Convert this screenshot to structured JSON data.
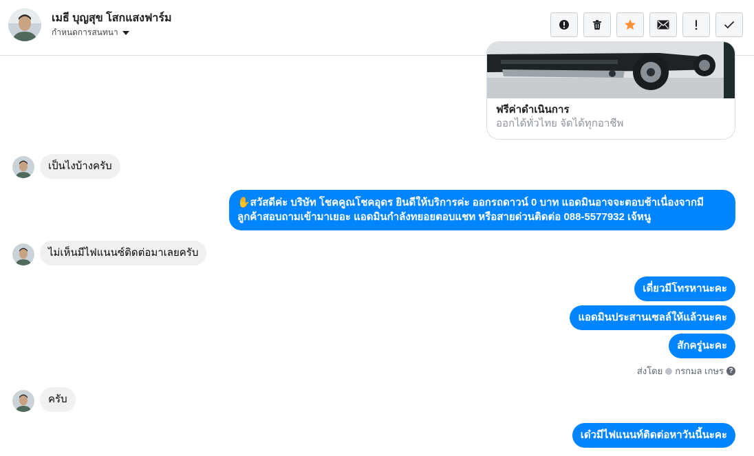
{
  "header": {
    "contact_name": "เมธี บุญสุข โสกแสงฟาร์ม",
    "assign_label": "กำหนดการสนทนา",
    "actions": [
      {
        "icon": "alert-circle-icon",
        "name": "report-button"
      },
      {
        "icon": "trash-icon",
        "name": "delete-button"
      },
      {
        "icon": "star-icon",
        "name": "star-button",
        "color": "#f7923b"
      },
      {
        "icon": "envelope-icon",
        "name": "mark-unread-button"
      },
      {
        "icon": "exclamation-icon",
        "name": "spam-button"
      },
      {
        "icon": "checkmark-icon",
        "name": "done-button"
      }
    ]
  },
  "card": {
    "title": "ฟรีค่าดำเนินการ",
    "subtitle": "ออกได้ทั่วไทย จัดได้ทุกอาชีพ"
  },
  "messages": [
    {
      "side": "in",
      "text": "เป็นไงบ้างครับ"
    },
    {
      "side": "out",
      "text": "✋สวัสดีค่ะ บริษัท โชคคูณโชคอุดร ยินดีให้บริการค่ะ ออกรถดาวน์ 0 บาท แอดมินอาจจะตอบช้าเนื่องจากมีลูกค้าสอบถามเข้ามาเยอะ แอดมินกำลังทยอยตอบแชท หรือสายด่วนติดต่อ 088-5577932 เจ้หนู"
    },
    {
      "side": "in",
      "text": "ไม่เห็นมีไฟแนนซ์ติดต่อมาเลยครับ"
    },
    {
      "side": "out",
      "text": "เดี่ยวมีโทรหานะคะ"
    },
    {
      "side": "out",
      "text": "แอดมินประสานเซลล์ให้แล้วนะคะ"
    },
    {
      "side": "out",
      "text": "สักครู่นะคะ"
    },
    {
      "side": "in",
      "text": "ครับ"
    },
    {
      "side": "out",
      "text": "เด๋วมีไฟแนนท์ติดต่อหาวันนี้นะคะ"
    }
  ],
  "sent_by": {
    "prefix": "ส่งโดย",
    "name": "กรกมล เกษร",
    "help": "?"
  },
  "colors": {
    "brand_blue": "#0084ff",
    "incoming_bg": "#f0f0f0",
    "star_orange": "#f7923b"
  }
}
